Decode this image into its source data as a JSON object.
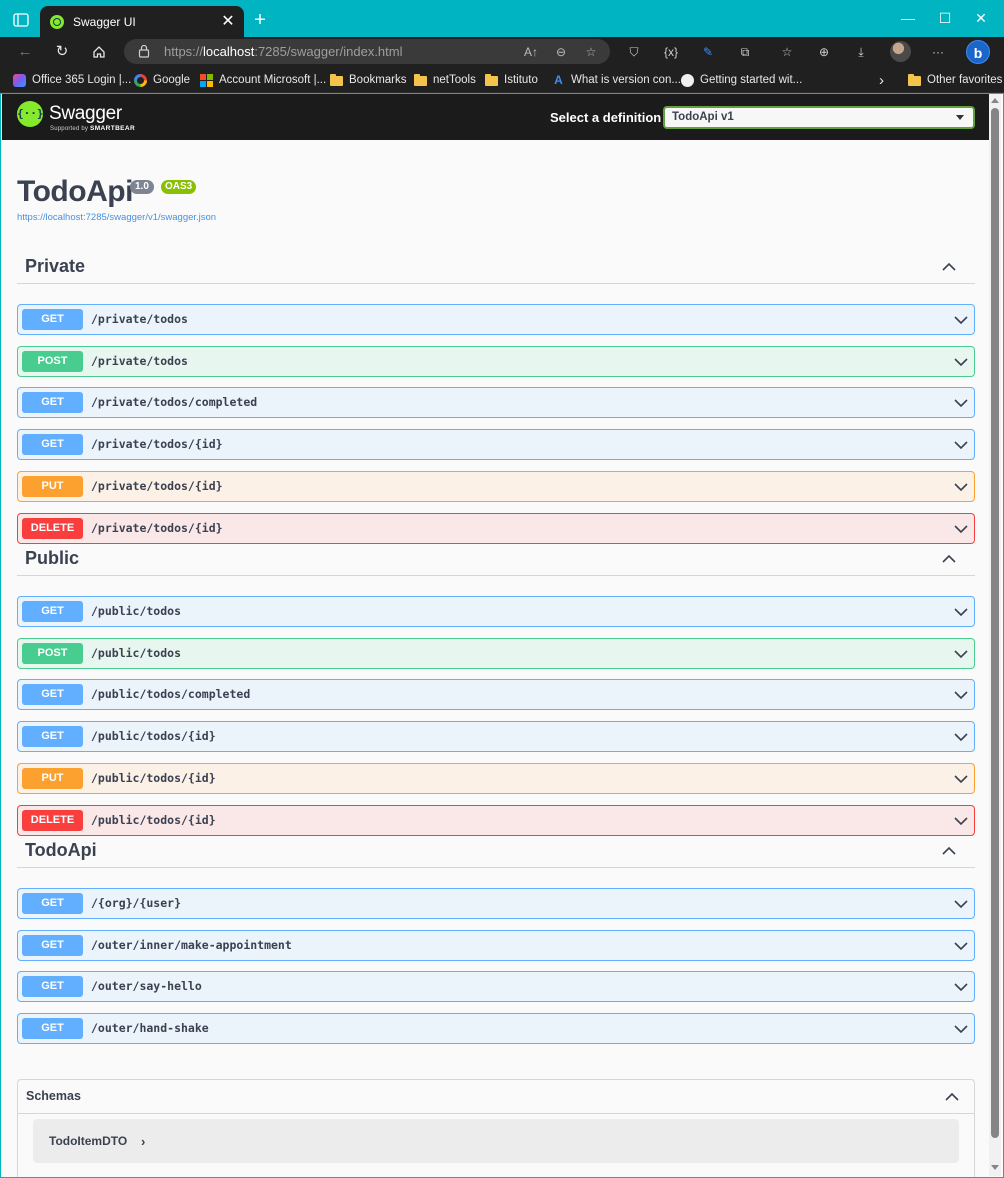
{
  "browser": {
    "tab_title": "Swagger UI",
    "tab_close": "✕",
    "new_tab": "+",
    "window_controls": [
      "—",
      "☐",
      "✕"
    ],
    "url_prefix": "https://",
    "url_host": "localhost",
    "url_rest": ":7285/swagger/index.html",
    "favorites": [
      {
        "label": "Office 365 Login |...",
        "icon": "office365-icon"
      },
      {
        "label": "Google",
        "icon": "google-icon"
      },
      {
        "label": "Account Microsoft |...",
        "icon": "microsoft-icon"
      },
      {
        "label": "Bookmarks",
        "icon": "folder-icon"
      },
      {
        "label": "netTools",
        "icon": "folder-icon"
      },
      {
        "label": "Istituto",
        "icon": "folder-icon"
      },
      {
        "label": "What is version con...",
        "icon": "azure-devops-icon"
      },
      {
        "label": "Getting started wit...",
        "icon": "github-icon"
      }
    ],
    "favorites_more": "›",
    "other_favorites": "Other favorites"
  },
  "swagger": {
    "logo_word": "Swagger",
    "logo_supported": "Supported by",
    "logo_smartbear": "SMARTBEAR",
    "definition_label": "Select a definition",
    "definition_value": "TodoApi v1",
    "title": "TodoApi",
    "version_badge": "1.0",
    "oas_badge": "OAS3",
    "spec_url": "https://localhost:7285/swagger/v1/swagger.json",
    "tags": [
      {
        "name": "Private",
        "operations": [
          {
            "method": "GET",
            "path": "/private/todos"
          },
          {
            "method": "POST",
            "path": "/private/todos"
          },
          {
            "method": "GET",
            "path": "/private/todos/completed"
          },
          {
            "method": "GET",
            "path": "/private/todos/{id}"
          },
          {
            "method": "PUT",
            "path": "/private/todos/{id}"
          },
          {
            "method": "DELETE",
            "path": "/private/todos/{id}"
          }
        ]
      },
      {
        "name": "Public",
        "operations": [
          {
            "method": "GET",
            "path": "/public/todos"
          },
          {
            "method": "POST",
            "path": "/public/todos"
          },
          {
            "method": "GET",
            "path": "/public/todos/completed"
          },
          {
            "method": "GET",
            "path": "/public/todos/{id}"
          },
          {
            "method": "PUT",
            "path": "/public/todos/{id}"
          },
          {
            "method": "DELETE",
            "path": "/public/todos/{id}"
          }
        ]
      },
      {
        "name": "TodoApi",
        "operations": [
          {
            "method": "GET",
            "path": "/{org}/{user}"
          },
          {
            "method": "GET",
            "path": "/outer/inner/make-appointment"
          },
          {
            "method": "GET",
            "path": "/outer/say-hello"
          },
          {
            "method": "GET",
            "path": "/outer/hand-shake"
          }
        ]
      }
    ],
    "schemas_title": "Schemas",
    "models": [
      {
        "name": "TodoItemDTO",
        "arrow": "›"
      }
    ]
  },
  "colors": {
    "get": "#61affe",
    "post": "#49cc90",
    "put": "#fca130",
    "delete": "#f93e3e",
    "swagger_green": "#85ea2d",
    "browser_accent": "#00b5c1"
  }
}
